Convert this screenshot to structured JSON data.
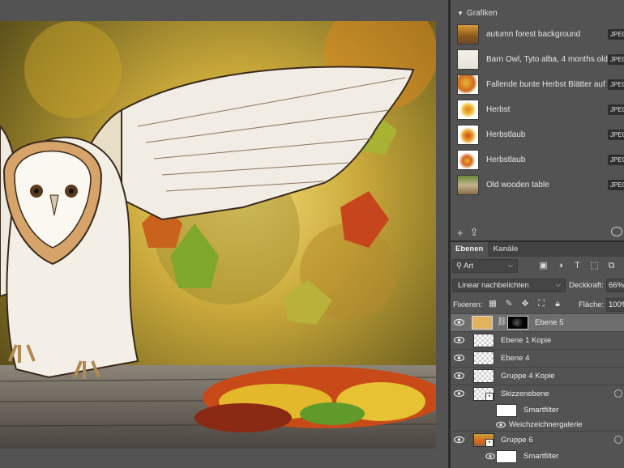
{
  "library": {
    "section_title": "Grafiken",
    "items": [
      {
        "name": "autumn forest background",
        "badge": "JPEG"
      },
      {
        "name": "Barn Owl, Tyto alba, 4 months old",
        "badge": "JPEG"
      },
      {
        "name": "Fallende bunte Herbst Blätter auf ...",
        "badge": "JPEG"
      },
      {
        "name": "Herbst",
        "badge": "JPEG"
      },
      {
        "name": "Herbstlaub",
        "badge": "JPEG"
      },
      {
        "name": "Herbstlaub",
        "badge": "JPEG"
      },
      {
        "name": "Old wooden table",
        "badge": "JPEG"
      }
    ]
  },
  "layers_panel": {
    "tabs": [
      {
        "label": "Ebenen",
        "active": true
      },
      {
        "label": "Kanäle",
        "active": false
      }
    ],
    "kind_filter": "Art",
    "blend_mode": "Linear nachbelichten",
    "opacity_label": "Deckkraft:",
    "opacity_value": "66%",
    "lock_label": "Fixieren:",
    "fill_label": "Fläche:",
    "fill_value": "100%",
    "layers": [
      {
        "name": "Ebene 5",
        "selected": true
      },
      {
        "name": "Ebene 1 Kopie"
      },
      {
        "name": "Ebene 4"
      },
      {
        "name": "Gruppe 4 Kopie"
      },
      {
        "name": "Skizzenebene"
      },
      {
        "name": "Gruppe 6"
      }
    ],
    "sub_items": {
      "skizzen_filter": "Smartfilter",
      "skizzen_effect": "Weichzeichnergalerie",
      "gruppe6_filter": "Smartfilter"
    }
  },
  "colors": {
    "panel_bg": "#535353",
    "selected_row": "#6e6e6e",
    "layer5_swatch": "#e3b25f"
  }
}
